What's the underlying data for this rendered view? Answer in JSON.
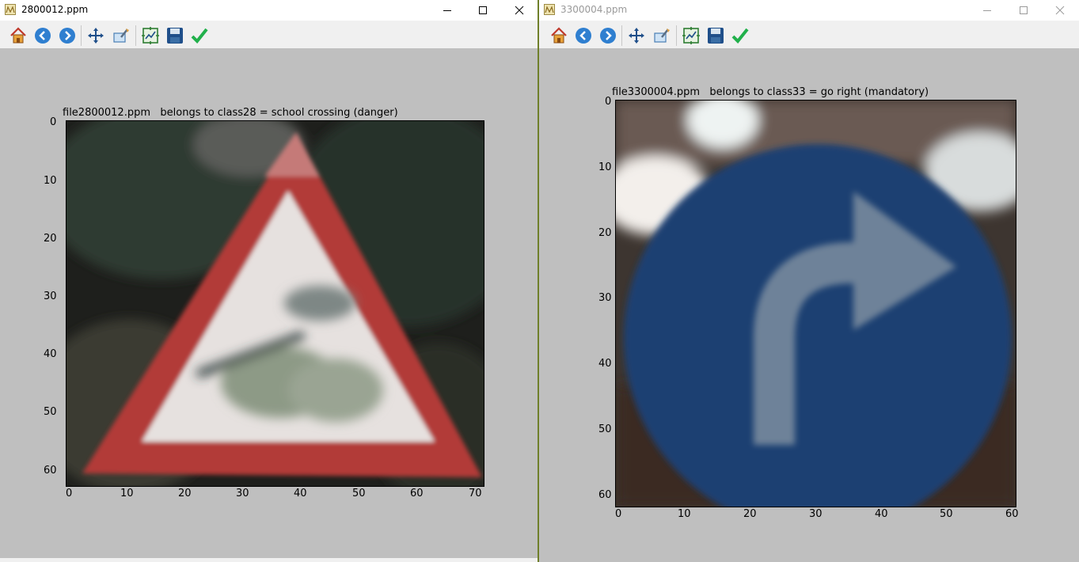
{
  "windows": [
    {
      "title": "2800012.ppm",
      "title_active": true,
      "plot_title": "file2800012.ppm   belongs to class28 = school crossing (danger)",
      "yticks": [
        "0",
        "10",
        "20",
        "30",
        "40",
        "50",
        "60"
      ],
      "xticks": [
        "0",
        "10",
        "20",
        "30",
        "40",
        "50",
        "60",
        "70"
      ]
    },
    {
      "title": "3300004.ppm",
      "title_active": false,
      "plot_title": "file3300004.ppm   belongs to class33 = go right (mandatory)",
      "yticks": [
        "0",
        "10",
        "20",
        "30",
        "40",
        "50",
        "60"
      ],
      "xticks": [
        "0",
        "10",
        "20",
        "30",
        "40",
        "50",
        "60"
      ]
    }
  ],
  "toolbar_icons": [
    "home-icon",
    "back-arrow-icon",
    "forward-arrow-icon",
    "pan-icon",
    "zoom-icon",
    "subplots-icon",
    "save-icon",
    "check-icon"
  ],
  "colors": {
    "figure_bg": "#bfbfbf",
    "toolbar_bg": "#f0f0f0",
    "window_divider": "#6f7f2a"
  }
}
